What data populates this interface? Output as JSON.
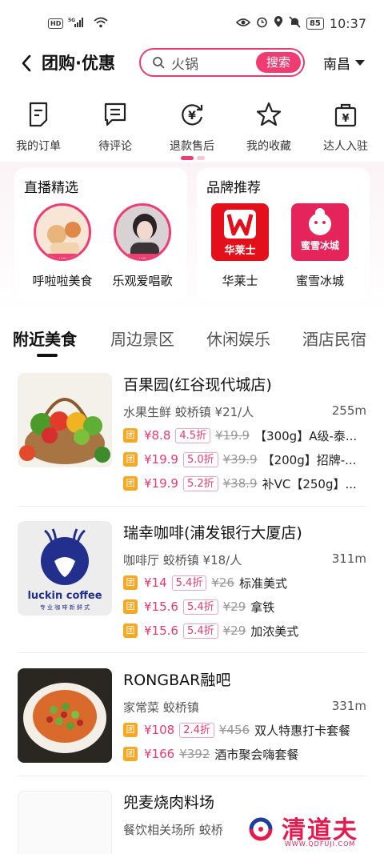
{
  "status": {
    "left": "HD 5G",
    "time": "10:37",
    "battery": "85"
  },
  "header": {
    "title": "团购·优惠",
    "search_text": "火锅",
    "search_button": "搜索",
    "city": "南昌"
  },
  "quick_links": [
    {
      "label": "我的订单",
      "icon": "order-icon"
    },
    {
      "label": "待评论",
      "icon": "comment-icon"
    },
    {
      "label": "退款售后",
      "icon": "refund-icon"
    },
    {
      "label": "我的收藏",
      "icon": "star-icon"
    },
    {
      "label": "达人入驻",
      "icon": "bag-icon"
    }
  ],
  "live_section": {
    "title": "直播精选",
    "badge": "直播中",
    "items": [
      {
        "name": "呼啦啦美食"
      },
      {
        "name": "乐观爱唱歌"
      }
    ]
  },
  "brand_section": {
    "title": "品牌推荐",
    "items": [
      {
        "name": "华莱士",
        "logo_text": "华莱士"
      },
      {
        "name": "蜜雪冰城",
        "logo_text": "蜜雪冰城"
      }
    ]
  },
  "category_tabs": [
    "附近美食",
    "周边景区",
    "休闲娱乐",
    "酒店民宿"
  ],
  "deal_badge": "团",
  "stores": [
    {
      "name": "百果园(红谷现代城店)",
      "meta": "水果生鲜 蛟桥镇 ¥21/人",
      "distance": "255m",
      "deals": [
        {
          "price": "¥8.8",
          "discount": "4.5折",
          "original": "¥19.9",
          "title": "【300g】A级-泰..."
        },
        {
          "price": "¥19.9",
          "discount": "5.0折",
          "original": "¥39.9",
          "title": "【200g】招牌-..."
        },
        {
          "price": "¥19.9",
          "discount": "5.2折",
          "original": "¥38.9",
          "title": "补VC【250g】..."
        }
      ]
    },
    {
      "name": "瑞幸咖啡(浦发银行大厦店)",
      "meta": "咖啡厅 蛟桥镇 ¥18/人",
      "distance": "311m",
      "logo_text": "luckin coffee",
      "logo_sub": "专 业 咖 啡 新 鲜 式",
      "deals": [
        {
          "price": "¥14",
          "discount": "5.4折",
          "original": "¥26",
          "title": "标准美式"
        },
        {
          "price": "¥15.6",
          "discount": "5.4折",
          "original": "¥29",
          "title": "拿铁"
        },
        {
          "price": "¥15.6",
          "discount": "5.4折",
          "original": "¥29",
          "title": "加浓美式"
        }
      ]
    },
    {
      "name": "RONGBAR融吧",
      "meta": "家常菜 蛟桥镇",
      "distance": "331m",
      "deals": [
        {
          "price": "¥108",
          "discount": "2.4折",
          "original": "¥456",
          "title": "双人特惠打卡套餐"
        },
        {
          "price": "¥166",
          "discount": "",
          "original": "¥392",
          "title": "酒市聚会嗨套餐"
        }
      ]
    },
    {
      "name": "兜麦烧肉料场",
      "meta": "餐饮相关场所 蛟桥"
    }
  ],
  "watermark": {
    "text": "清道夫",
    "url": "WWW.QDFUJI.COM"
  },
  "colors": {
    "accent": "#ef3d73",
    "tuan": "#f7a823"
  }
}
